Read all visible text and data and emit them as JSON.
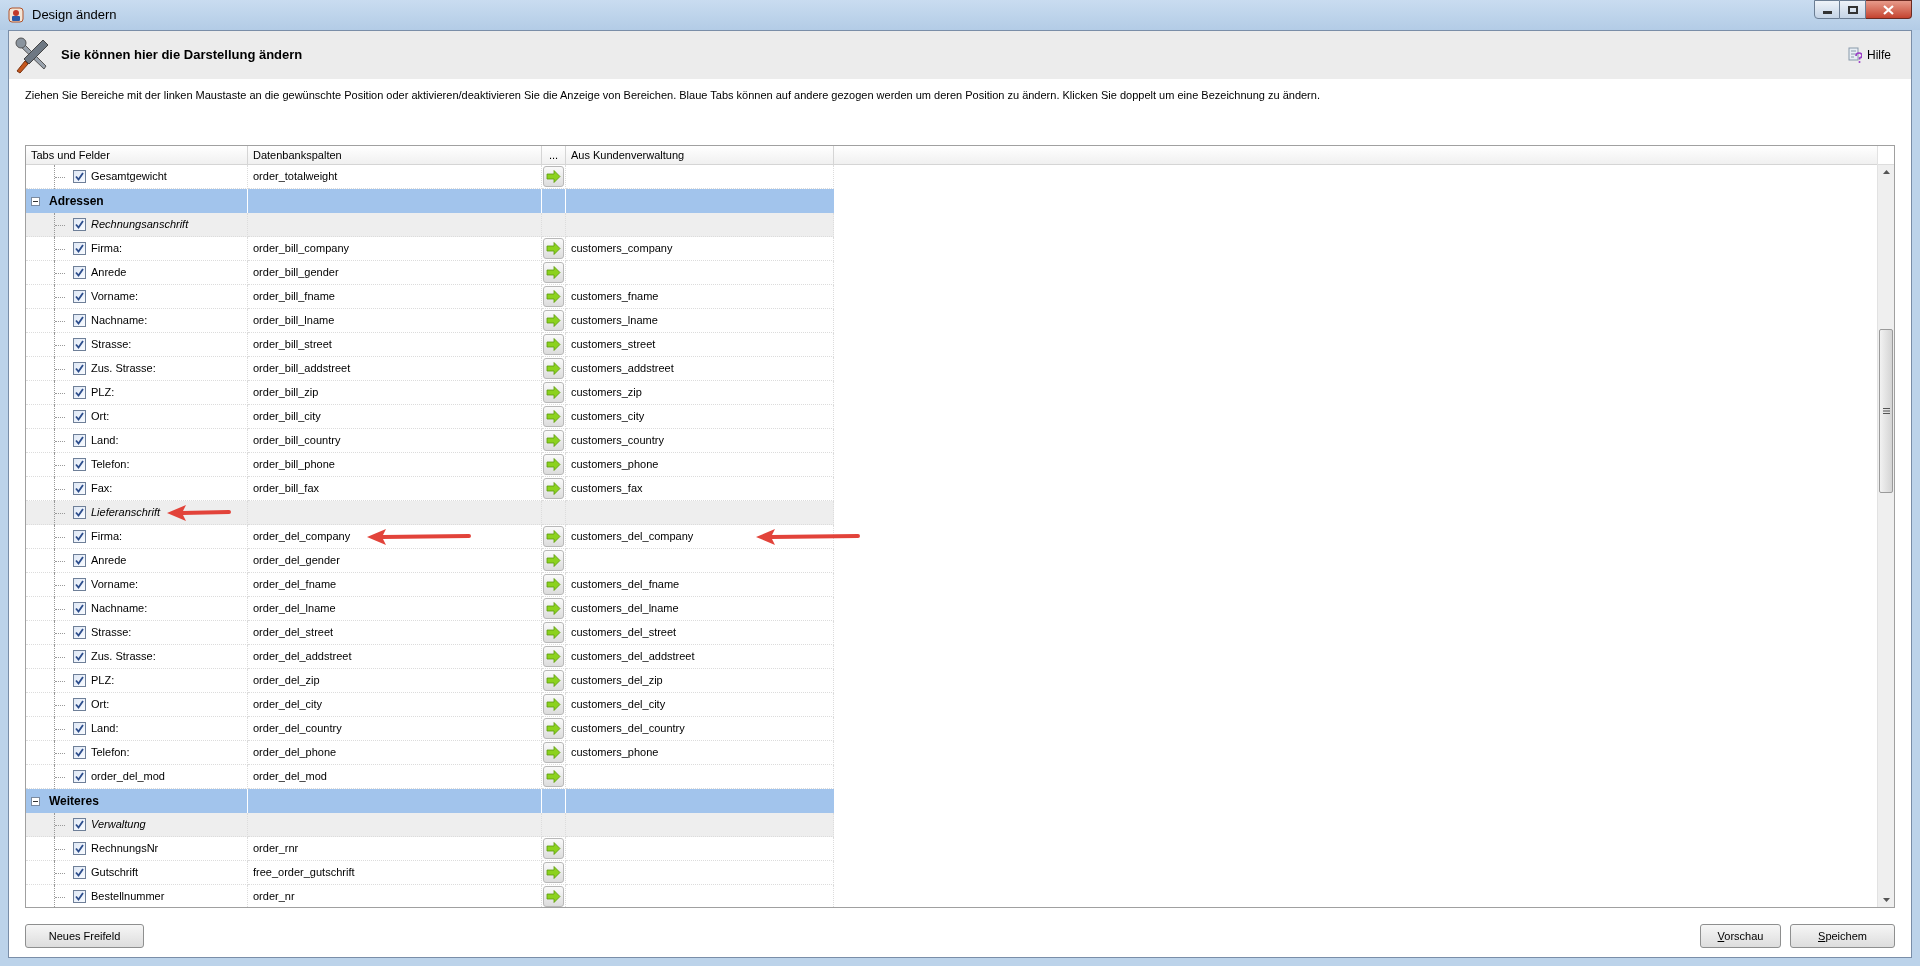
{
  "window": {
    "title": "Design ändern"
  },
  "header": {
    "title": "Sie können hier die Darstellung ändern",
    "help": "Hilfe"
  },
  "description": "Ziehen Sie Bereiche mit der linken Maustaste an die gewünschte Position oder aktivieren/deaktivieren Sie die Anzeige von Bereichen. Blaue Tabs können auf andere gezogen werden um deren Position zu ändern. Klicken Sie doppelt um eine Bezeichnung zu ändern.",
  "table": {
    "columns": [
      "Tabs und Felder",
      "Datenbankspalten",
      "...",
      "Aus Kundenverwaltung"
    ],
    "leading_rows": [
      {
        "kind": "field",
        "label": "Gesamtgewicht",
        "checked": true,
        "db_column": "order_totalweight"
      }
    ],
    "tabs": [
      {
        "label": "Adressen",
        "expanded": true,
        "children": [
          {
            "kind": "group",
            "label": "Rechnungsanschrift",
            "checked": true
          },
          {
            "kind": "field",
            "label": "Firma:",
            "checked": true,
            "db_column": "order_bill_company",
            "customer_column": "customers_company"
          },
          {
            "kind": "field",
            "label": "Anrede",
            "checked": true,
            "db_column": "order_bill_gender"
          },
          {
            "kind": "field",
            "label": "Vorname:",
            "checked": true,
            "db_column": "order_bill_fname",
            "customer_column": "customers_fname"
          },
          {
            "kind": "field",
            "label": "Nachname:",
            "checked": true,
            "db_column": "order_bill_lname",
            "customer_column": "customers_lname"
          },
          {
            "kind": "field",
            "label": "Strasse:",
            "checked": true,
            "db_column": "order_bill_street",
            "customer_column": "customers_street"
          },
          {
            "kind": "field",
            "label": "Zus. Strasse:",
            "checked": true,
            "db_column": "order_bill_addstreet",
            "customer_column": "customers_addstreet"
          },
          {
            "kind": "field",
            "label": "PLZ:",
            "checked": true,
            "db_column": "order_bill_zip",
            "customer_column": "customers_zip"
          },
          {
            "kind": "field",
            "label": "Ort:",
            "checked": true,
            "db_column": "order_bill_city",
            "customer_column": "customers_city"
          },
          {
            "kind": "field",
            "label": "Land:",
            "checked": true,
            "db_column": "order_bill_country",
            "customer_column": "customers_country"
          },
          {
            "kind": "field",
            "label": "Telefon:",
            "checked": true,
            "db_column": "order_bill_phone",
            "customer_column": "customers_phone"
          },
          {
            "kind": "field",
            "label": "Fax:",
            "checked": true,
            "db_column": "order_bill_fax",
            "customer_column": "customers_fax"
          },
          {
            "kind": "group",
            "label": "Lieferanschrift",
            "checked": true,
            "label_marked": true
          },
          {
            "kind": "field",
            "label": "Firma:",
            "checked": true,
            "db_column": "order_del_company",
            "customer_column": "customers_del_company",
            "db_column_marked": true,
            "customer_column_marked": true
          },
          {
            "kind": "field",
            "label": "Anrede",
            "checked": true,
            "db_column": "order_del_gender"
          },
          {
            "kind": "field",
            "label": "Vorname:",
            "checked": true,
            "db_column": "order_del_fname",
            "customer_column": "customers_del_fname"
          },
          {
            "kind": "field",
            "label": "Nachname:",
            "checked": true,
            "db_column": "order_del_lname",
            "customer_column": "customers_del_lname"
          },
          {
            "kind": "field",
            "label": "Strasse:",
            "checked": true,
            "db_column": "order_del_street",
            "customer_column": "customers_del_street"
          },
          {
            "kind": "field",
            "label": "Zus. Strasse:",
            "checked": true,
            "db_column": "order_del_addstreet",
            "customer_column": "customers_del_addstreet"
          },
          {
            "kind": "field",
            "label": "PLZ:",
            "checked": true,
            "db_column": "order_del_zip",
            "customer_column": "customers_del_zip"
          },
          {
            "kind": "field",
            "label": "Ort:",
            "checked": true,
            "db_column": "order_del_city",
            "customer_column": "customers_del_city"
          },
          {
            "kind": "field",
            "label": "Land:",
            "checked": true,
            "db_column": "order_del_country",
            "customer_column": "customers_del_country"
          },
          {
            "kind": "field",
            "label": "Telefon:",
            "checked": true,
            "db_column": "order_del_phone",
            "customer_column": "customers_phone"
          },
          {
            "kind": "field",
            "label": "order_del_mod",
            "checked": true,
            "db_column": "order_del_mod"
          }
        ]
      },
      {
        "label": "Weiteres",
        "expanded": true,
        "children": [
          {
            "kind": "group",
            "label": "Verwaltung",
            "checked": true
          },
          {
            "kind": "field",
            "label": "RechnungsNr",
            "checked": true,
            "db_column": "order_rnr"
          },
          {
            "kind": "field",
            "label": "Gutschrift",
            "checked": true,
            "db_column": "free_order_gutschrift"
          },
          {
            "kind": "field",
            "label": "Bestellnummer",
            "checked": true,
            "db_column": "order_nr"
          }
        ]
      }
    ]
  },
  "buttons": {
    "left": [
      "Neues Freifeld"
    ],
    "right": [
      "Vorschau",
      "Speichem"
    ]
  }
}
